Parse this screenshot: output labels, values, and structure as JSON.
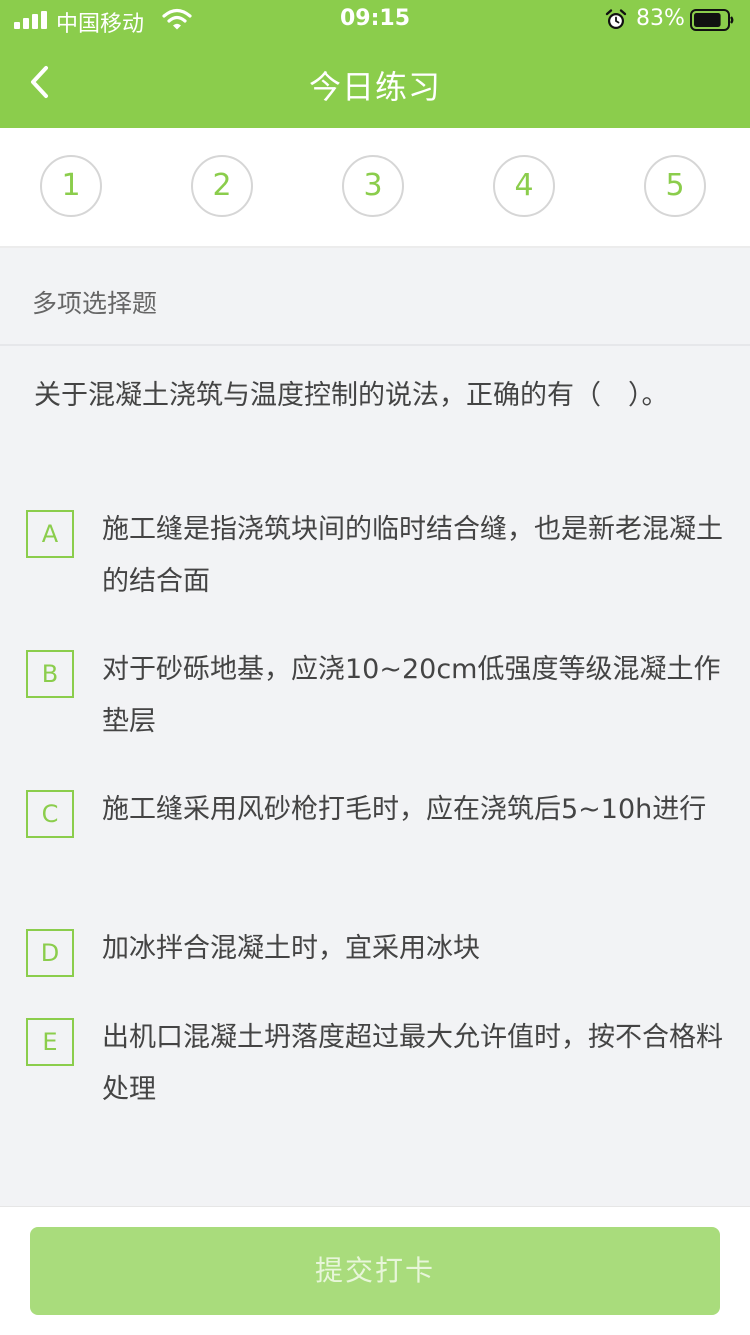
{
  "status_bar": {
    "carrier": "中国移动",
    "time": "09:15",
    "battery_percent": "83%",
    "battery_level": 0.83,
    "icons": [
      "signal-icon",
      "wifi-icon",
      "alarm-icon",
      "battery-icon"
    ]
  },
  "nav": {
    "title": "今日练习",
    "back_icon": "chevron-left-icon"
  },
  "steps": {
    "items": [
      {
        "label": "1",
        "active": false
      },
      {
        "label": "2",
        "active": false
      },
      {
        "label": "3",
        "active": false
      },
      {
        "label": "4",
        "active": false
      },
      {
        "label": "5",
        "active": true
      }
    ]
  },
  "question": {
    "type": "多项选择题",
    "text": "关于混凝土浇筑与温度控制的说法，正确的有（　）。",
    "options": [
      {
        "letter": "A",
        "text": "施工缝是指浇筑块间的临时结合缝，也是新老混凝土的结合面"
      },
      {
        "letter": "B",
        "text": "对于砂砾地基，应浇10~20cm低强度等级混凝土作垫层"
      },
      {
        "letter": "C",
        "text": "施工缝采用风砂枪打毛时，应在浇筑后5~10h进行"
      },
      {
        "letter": "D",
        "text": "加冰拌合混凝土时，宜采用冰块"
      },
      {
        "letter": "E",
        "text": "出机口混凝土坍落度超过最大允许值时，按不合格料处理"
      }
    ]
  },
  "footer": {
    "submit_label": "提交打卡"
  },
  "colors": {
    "brand_green": "#8bcd4c",
    "submit_disabled": "#a9dc7c",
    "background": "#f2f3f5"
  }
}
